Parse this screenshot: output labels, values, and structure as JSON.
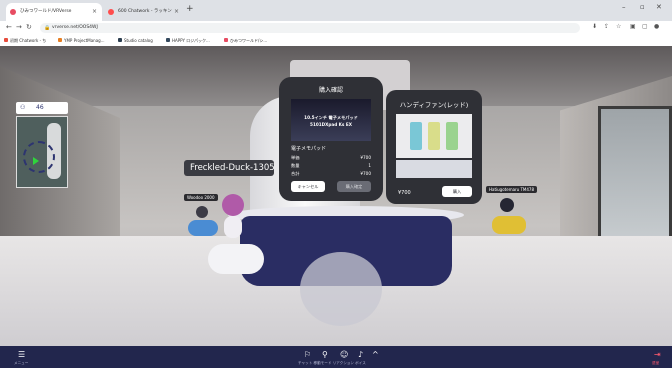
{
  "browser": {
    "tabs": [
      {
        "title": "ひみつワールド/VRVerse",
        "active": true,
        "color": "#e74c62"
      },
      {
        "title": "600 Chatwork - ラッキン",
        "active": false,
        "color": "#ff4d4d"
      }
    ],
    "url": "vrverse.net/OOS4WJ",
    "bookmarks": [
      "初期 Chatwork - ち",
      "YMP ProjectManag...",
      "Studio catalog",
      "HAPPY ロジパック...",
      "ひみつワールド/シ..."
    ]
  },
  "minimap": {
    "mode_icon": "people-icon",
    "count_label": "46"
  },
  "scene": {
    "nametag_main": "Freckled-Duck-1305...",
    "nametag_left": "Woodoo 2000",
    "nametag_right": "Hatiugotemaru TM478"
  },
  "purchase_panel": {
    "title": "購入確認",
    "product_caption_1": "10.5インチ 電子メモパッド",
    "product_caption_2": "5101DXpad Ks EX",
    "product_name": "電子メモパッド",
    "rows": [
      {
        "label": "単価",
        "value": "¥700"
      },
      {
        "label": "数量",
        "value": "1"
      },
      {
        "label": "合計",
        "value": "¥700"
      }
    ],
    "cancel": "キャンセル",
    "confirm": "購入確定"
  },
  "product_panel": {
    "title": "ハンディファン(レッド)",
    "price": "¥700",
    "buy": "購入"
  },
  "toolbar": {
    "menu_label": "メニュー",
    "center_labels": "チャット 移動モード リアクション ボイス",
    "leave_label": "退室"
  },
  "colors": {
    "navy": "#22264d",
    "panel": "#2f3036",
    "accent_green": "#2fd43c"
  }
}
